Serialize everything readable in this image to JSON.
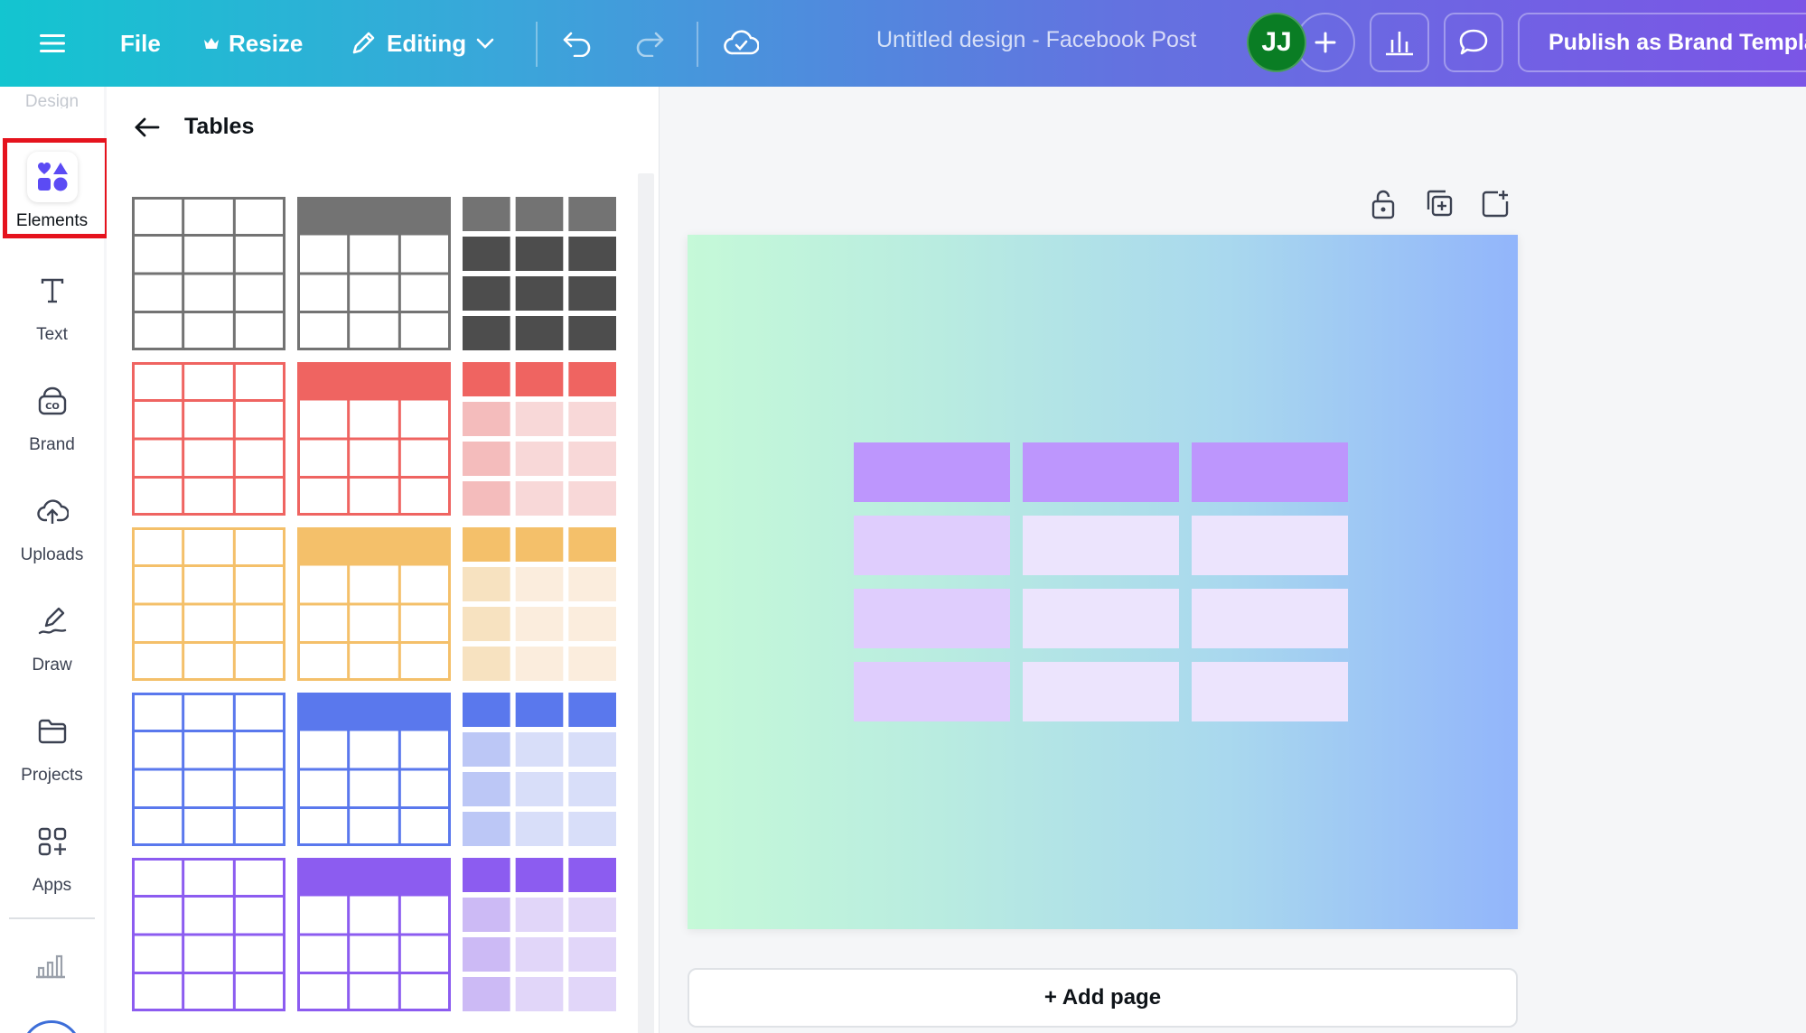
{
  "topbar": {
    "file": "File",
    "resize": "Resize",
    "editing": "Editing",
    "doc_title": "Untitled design - Facebook Post",
    "avatar_initials": "JJ",
    "publish": "Publish as Brand Template"
  },
  "rail": {
    "faded_label": "Design",
    "items": [
      {
        "label": "Elements",
        "icon": "shapes-icon"
      },
      {
        "label": "Text",
        "icon": "text-icon"
      },
      {
        "label": "Brand",
        "icon": "brand-icon"
      },
      {
        "label": "Uploads",
        "icon": "upload-cloud-icon"
      },
      {
        "label": "Draw",
        "icon": "draw-icon"
      },
      {
        "label": "Projects",
        "icon": "folder-icon"
      },
      {
        "label": "Apps",
        "icon": "apps-icon"
      }
    ]
  },
  "panel": {
    "title": "Tables",
    "table_styles": [
      {
        "color": "#737373",
        "tint_dark": "#4d4d4d",
        "tint_a": "#4d4d4d",
        "tint_b": "#4d4d4d"
      },
      {
        "color": "#ef6461",
        "tint_dark": "#ef6461",
        "tint_a": "#f4bcbc",
        "tint_b": "#f8d8d8"
      },
      {
        "color": "#f4c06a",
        "tint_dark": "#f4c06a",
        "tint_a": "#f7e2c0",
        "tint_b": "#fbeddd"
      },
      {
        "color": "#5a78ed",
        "tint_dark": "#5a78ed",
        "tint_a": "#bcc7f6",
        "tint_b": "#d8def9"
      },
      {
        "color": "#8c5cf0",
        "tint_dark": "#8c5cf0",
        "tint_a": "#ccbaf5",
        "tint_b": "#e1d6f9"
      }
    ]
  },
  "canvas": {
    "header_color": "#bd96fd",
    "body_color_a": "#dfcdfd",
    "body_color_b": "#ece4fd",
    "rows": 4,
    "cols": 3
  },
  "add_page": "+ Add page"
}
